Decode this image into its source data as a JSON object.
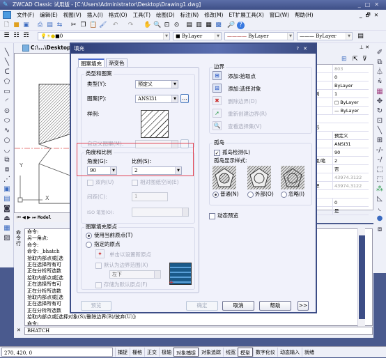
{
  "window": {
    "title": "ZWCAD Classic 试用版 - [C:\\Users\\Administrator\\Desktop\\Drawing1.dwg]",
    "controls": [
      "_",
      "□",
      "✕"
    ]
  },
  "menubar": {
    "items": [
      "文件(F)",
      "编辑(E)",
      "视图(V)",
      "插入(I)",
      "格式(O)",
      "工具(T)",
      "绘图(D)",
      "标注(N)",
      "修改(M)",
      "ET扩展工具(X)",
      "窗口(W)",
      "帮助(H)"
    ],
    "mdi_controls": [
      "_",
      "🗗",
      "✕"
    ]
  },
  "layer_toolbar": {
    "layer_value": "0",
    "color_value": "ByLayer",
    "linetype_value": "ByLayer",
    "lineweight_value": "ByLayer"
  },
  "document": {
    "tab_label": "C:\\...\\Desktop\\D",
    "model_tab": "Model",
    "ucs_x": "X",
    "ucs_y": "Y"
  },
  "properties": {
    "rows": [
      {
        "key": "",
        "value": "803"
      },
      {
        "key": "",
        "value": "0"
      },
      {
        "key": "",
        "value": "ByLayer"
      },
      {
        "key": "例",
        "value": "1"
      },
      {
        "key": "",
        "value": "□ ByLayer"
      },
      {
        "key": "",
        "value": "— ByLayer"
      },
      {
        "key": "",
        "value": ""
      },
      {
        "key": "形",
        "value": ""
      },
      {
        "key": "",
        "value": "预定义"
      },
      {
        "key": "",
        "value": "ANSI31"
      },
      {
        "key": "",
        "value": "90"
      },
      {
        "key": "距/笔",
        "value": "2"
      },
      {
        "key": "",
        "value": "否"
      },
      {
        "key": "",
        "value": "43974.3122"
      },
      {
        "key": "积",
        "value": "43974.3122"
      },
      {
        "key": "",
        "value": ""
      },
      {
        "key": "",
        "value": "0"
      },
      {
        "key": "",
        "value": "是"
      }
    ]
  },
  "command": {
    "label": "命令行",
    "lines": [
      "命令:",
      "另一角点:",
      "命令:",
      "命令: _bhatch",
      "拾取内部点或[选",
      "正在选择所有可",
      "正在分析所选数",
      "拾取内部点或[选",
      "正在选择所有可",
      "正在分析所选数",
      "拾取内部点或[选",
      "正在选择所有可",
      "正在分析所选数",
      "拾取内部点或[选择对象(S)/删除边界(B)/放弃(U)]:",
      "命令:",
      "命令:"
    ],
    "input": "BHATCH"
  },
  "statusbar": {
    "coords": "270, 420, 0",
    "buttons": [
      {
        "label": "捕捉",
        "on": false
      },
      {
        "label": "栅格",
        "on": false
      },
      {
        "label": "正交",
        "on": false
      },
      {
        "label": "极轴",
        "on": false
      },
      {
        "label": "对象捕捉",
        "on": true
      },
      {
        "label": "对象追踪",
        "on": false
      },
      {
        "label": "线宽",
        "on": false
      },
      {
        "label": "模型",
        "on": true
      },
      {
        "label": "数字化仪",
        "on": false
      },
      {
        "label": "动态输入",
        "on": false
      },
      {
        "label": "就绪",
        "on": false
      }
    ]
  },
  "dialog": {
    "title": "填充",
    "title_controls": [
      "?",
      "✕"
    ],
    "tabs": [
      {
        "label": "图案填充",
        "active": true
      },
      {
        "label": "渐变色",
        "active": false
      }
    ],
    "type_pattern": {
      "group_label": "类型和图案",
      "type_label": "类型(Y):",
      "type_value": "预定义",
      "pattern_label": "图案(P):",
      "pattern_value": "ANSI31",
      "browse_label": "...",
      "sample_label": "样例:",
      "custom_label": "自定义图案(M):",
      "custom_value": ""
    },
    "angle_scale": {
      "group_label": "角度和比例",
      "angle_label": "角度(G):",
      "angle_value": "90",
      "scale_label": "比例(S):",
      "scale_value": "2",
      "double_label": "双向(U)",
      "relative_label": "相对图纸空间(E)",
      "spacing_label": "间距(C):",
      "spacing_value": "1",
      "iso_label": "ISO 笔宽(O):",
      "iso_value": ""
    },
    "origin": {
      "group_label": "图案填充原点",
      "use_current_label": "使用当前原点(T)",
      "specified_label": "指定的原点",
      "click_set_label": "单击以设置新原点",
      "default_extent_label": "默认为边界范围(X)",
      "extent_value": "左下",
      "store_default_label": "存储为默认原点(F)"
    },
    "boundary": {
      "group_label": "边界",
      "add_pick_label": "添加:拾取点",
      "add_select_label": "添加:选择对象",
      "remove_label": "删除边界(D)",
      "recreate_label": "重新创建边界(R)",
      "view_label": "查看选择集(V)"
    },
    "islands": {
      "group_label": "孤岛",
      "detect_label": "孤岛检测(L)",
      "detect_checked": true,
      "style_label": "孤岛显示样式:",
      "styles": [
        {
          "label": "普通(N)",
          "selected": true
        },
        {
          "label": "外部(O)",
          "selected": false
        },
        {
          "label": "忽略(I)",
          "selected": false
        }
      ]
    },
    "dynamic_preview_label": "动态预览",
    "buttons": {
      "preview": "预览",
      "ok": "确定",
      "cancel": "取消",
      "help": "帮助",
      "more": ">>"
    }
  },
  "colors": {
    "title_bar": "#3e4f86",
    "highlight_box": "#e04050",
    "toolbar_bg": "#eef0f8"
  }
}
